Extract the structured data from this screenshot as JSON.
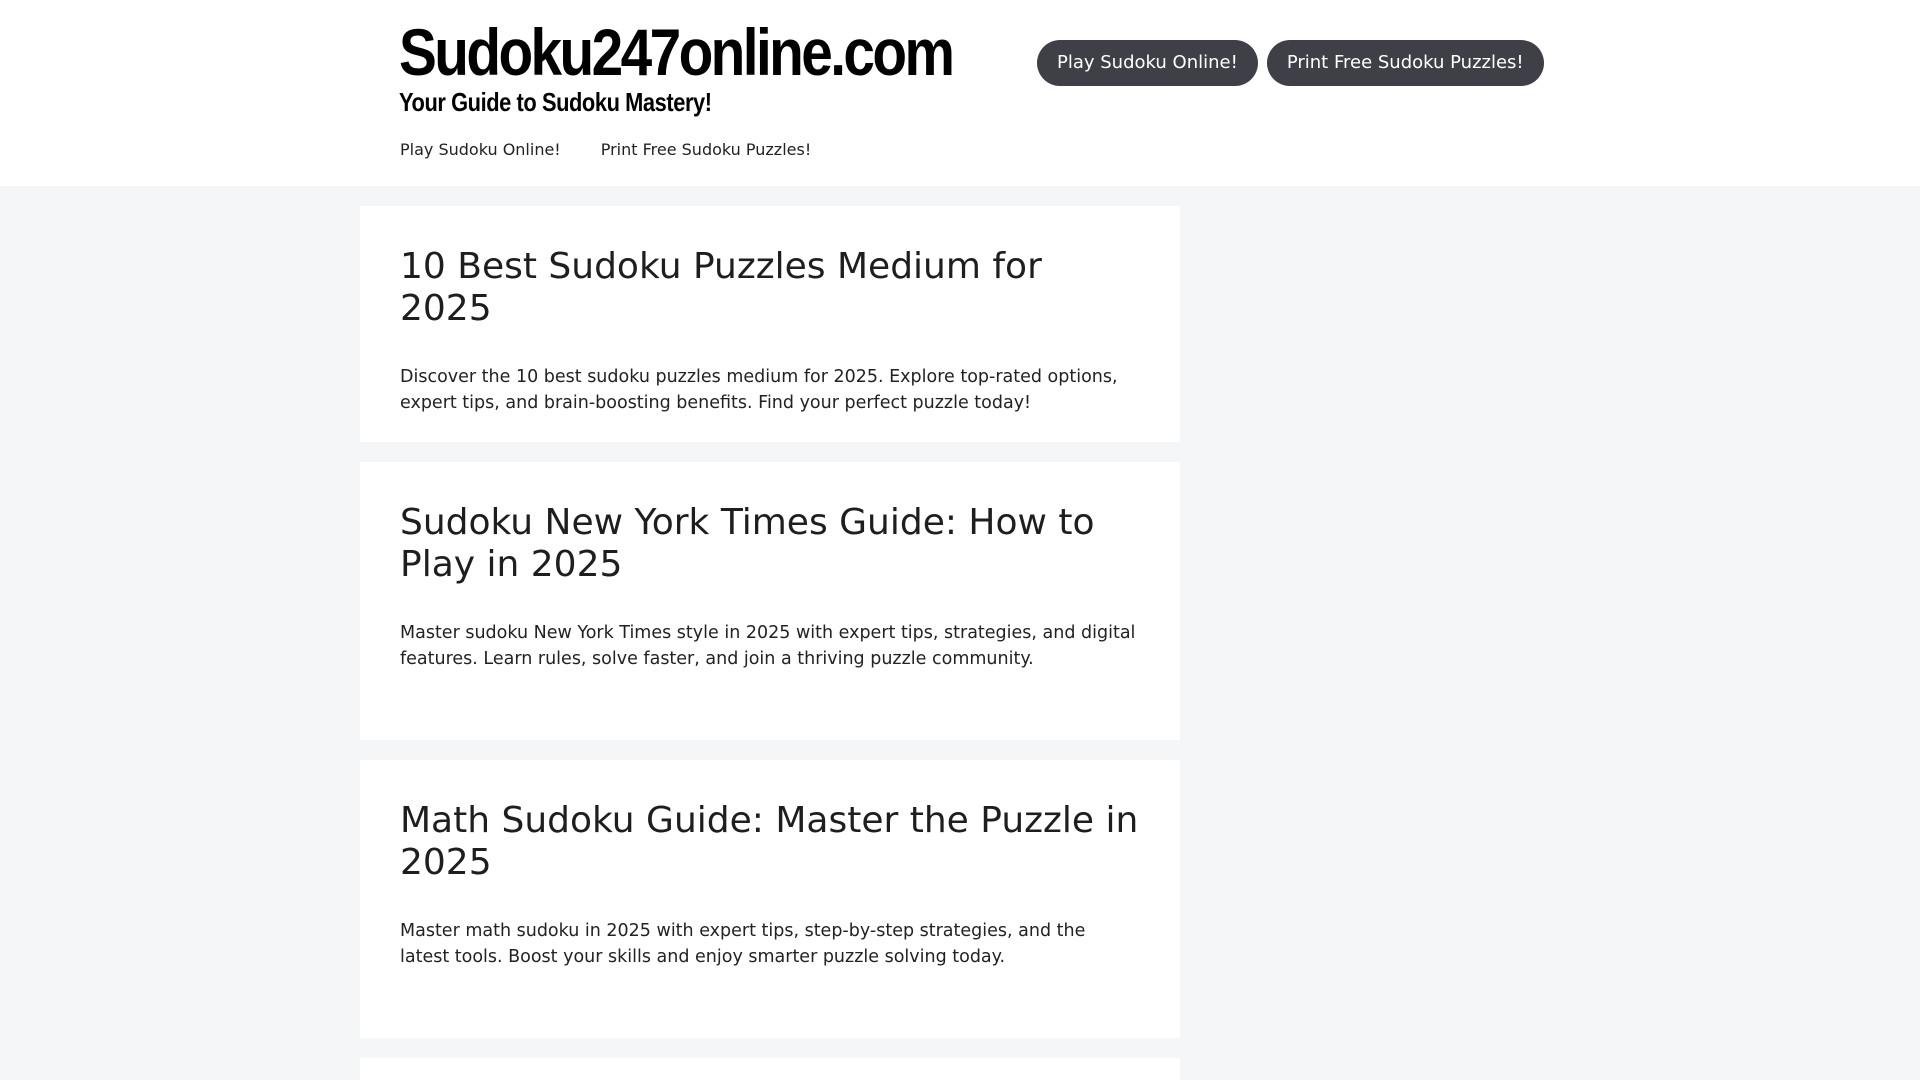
{
  "site": {
    "title": "Sudoku247online.com",
    "tagline": "Your Guide to Sudoku Mastery!"
  },
  "header_buttons": [
    {
      "label": "Play Sudoku Online!"
    },
    {
      "label": "Print Free Sudoku Puzzles!"
    }
  ],
  "nav": [
    {
      "label": "Play Sudoku Online!"
    },
    {
      "label": "Print Free Sudoku Puzzles!"
    }
  ],
  "posts": [
    {
      "title": "10 Best Sudoku Puzzles Medium for 2025",
      "excerpt": "Discover the 10 best sudoku puzzles medium for 2025. Explore top-rated options, expert tips, and brain-boosting benefits. Find your perfect puzzle today!"
    },
    {
      "title": "Sudoku New York Times Guide: How to Play in 2025",
      "excerpt": "Master sudoku New York Times style in 2025 with expert tips, strategies, and digital features. Learn rules, solve faster, and join a thriving puzzle community."
    },
    {
      "title": "Math Sudoku Guide: Master the Puzzle in 2025",
      "excerpt": "Master math sudoku in 2025 with expert tips, step-by-step strategies, and the latest tools. Boost your skills and enjoy smarter puzzle solving today."
    }
  ],
  "colors": {
    "page_background": "#f5f6f8",
    "button_background": "#3f4047",
    "button_text": "#ffffff"
  }
}
